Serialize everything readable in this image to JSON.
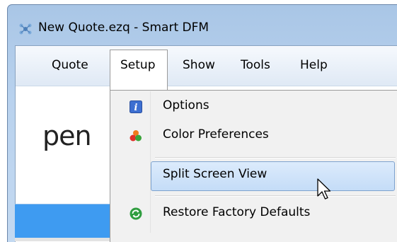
{
  "window": {
    "title": "New Quote.ezq - Smart DFM"
  },
  "menubar": {
    "items": [
      {
        "label": "Quote"
      },
      {
        "label": "Setup"
      },
      {
        "label": "Show"
      },
      {
        "label": "Tools"
      },
      {
        "label": "Help"
      }
    ]
  },
  "content": {
    "logo_text": "pen"
  },
  "dropdown": {
    "items": [
      {
        "label": "Options",
        "icon": "info-icon"
      },
      {
        "label": "Color Preferences",
        "icon": "color-preferences-icon"
      },
      {
        "label": "Split Screen View",
        "icon": "",
        "highlighted": true
      },
      {
        "label": "Restore Factory Defaults",
        "icon": "restore-icon"
      }
    ]
  },
  "colors": {
    "highlight": "#c4dcf7",
    "band": "#3e9bf1",
    "title_bar": "#b9d2ee"
  }
}
